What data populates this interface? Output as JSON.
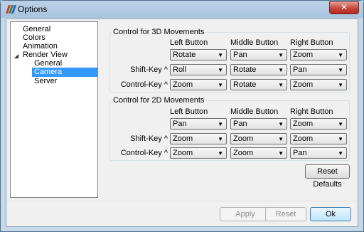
{
  "window": {
    "title": "Options",
    "close_glyph": "✕"
  },
  "tree": {
    "items": [
      {
        "label": "General"
      },
      {
        "label": "Colors"
      },
      {
        "label": "Animation"
      },
      {
        "label": "Render View"
      },
      {
        "label": "General"
      },
      {
        "label": "Camera",
        "selected": true
      },
      {
        "label": "Server"
      }
    ],
    "expand_glyph": "◢"
  },
  "group3d": {
    "title": "Control for 3D Movements",
    "headers": [
      "Left Button",
      "Middle Button",
      "Right Button"
    ],
    "rows": [
      {
        "label": "",
        "values": [
          "Rotate",
          "Pan",
          "Zoom"
        ]
      },
      {
        "label": "Shift-Key ^",
        "values": [
          "Roll",
          "Rotate",
          "Pan"
        ]
      },
      {
        "label": "Control-Key ^",
        "values": [
          "Zoom",
          "Rotate",
          "Zoom"
        ]
      }
    ]
  },
  "group2d": {
    "title": "Control for 2D Movements",
    "headers": [
      "Left Button",
      "Middle Button",
      "Right Button"
    ],
    "rows": [
      {
        "label": "",
        "values": [
          "Pan",
          "Pan",
          "Zoom"
        ]
      },
      {
        "label": "Shift-Key ^",
        "values": [
          "Zoom",
          "Zoom",
          "Zoom"
        ]
      },
      {
        "label": "Control-Key ^",
        "values": [
          "Zoom",
          "Zoom",
          "Pan"
        ]
      }
    ]
  },
  "buttons": {
    "reset_defaults": "Reset Defaults",
    "apply": "Apply",
    "reset": "Reset",
    "ok": "Ok"
  },
  "combo_arrow": "▼"
}
